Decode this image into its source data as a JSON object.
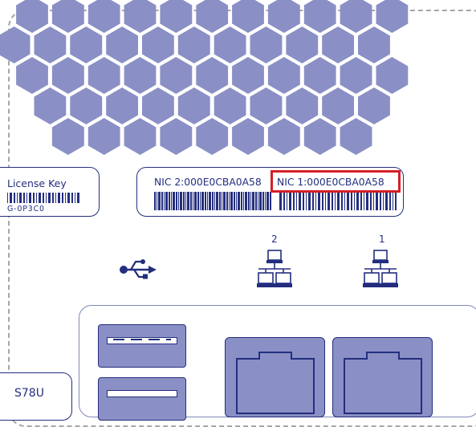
{
  "colors": {
    "accent": "#232e7e",
    "hexagon": "#8a90c5",
    "highlight": "#d31f26",
    "dash": "#a7a7a7"
  },
  "license_label": {
    "title": "License Key",
    "code": "G-0P3C0"
  },
  "nic_label": {
    "nic2": "NIC 2:000E0CBA0A58",
    "nic1": "NIC 1:000E0CBA0A58"
  },
  "ports": {
    "usb_icon": "usb-icon",
    "network_icon": "network-icon",
    "port2_number": "2",
    "port1_number": "1"
  },
  "model_label": {
    "text": "S78U"
  }
}
